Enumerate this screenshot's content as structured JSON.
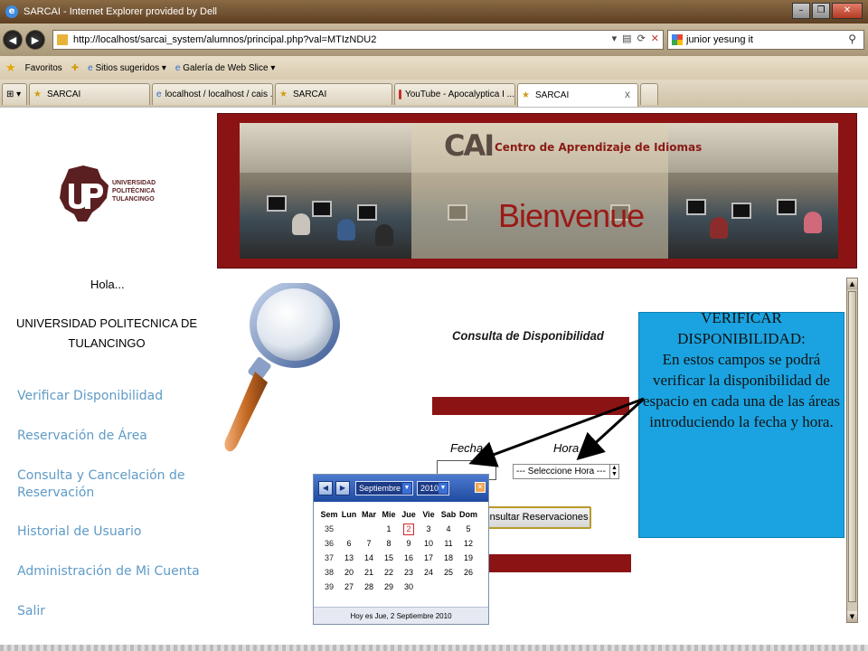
{
  "window": {
    "title": "SARCAI - Internet Explorer provided by Dell"
  },
  "browser": {
    "url": "http://localhost/sarcai_system/alumnos/principal.php?val=MTIzNDU2",
    "search_value": "junior yesung it",
    "favorites_label": "Favoritos",
    "suggested_sites_label": "Sitios sugeridos",
    "web_slice_label": "Galería de Web Slice",
    "tabs": [
      {
        "label": "SARCAI",
        "active": false
      },
      {
        "label": "localhost / localhost / cais ...",
        "active": false
      },
      {
        "label": "SARCAI",
        "active": false
      },
      {
        "label": "YouTube - Apocalyptica I ...",
        "active": false
      },
      {
        "label": "SARCAI",
        "active": true
      }
    ]
  },
  "sidebar": {
    "logo_text": [
      "UNIVERSIDAD",
      "POLITÉCNICA",
      "TULANCINGO"
    ],
    "greeting": "Hola...",
    "user_name": "UNIVERSIDAD POLITECNICA DE TULANCINGO",
    "nav": [
      {
        "label": "Verificar Disponibilidad"
      },
      {
        "label": "Reservación de Área"
      },
      {
        "label": "Consulta y Cancelación de Reservación"
      },
      {
        "label": "Historial de Usuario"
      },
      {
        "label": "Administración de Mi Cuenta"
      },
      {
        "label": "Salir"
      }
    ],
    "nav_color": "#5f9bc7"
  },
  "banner": {
    "logo": "CAI",
    "center_name": "Centro de Aprendizaje de Idiomas",
    "welcome": "Bienvenue",
    "frame_color": "#8c1314"
  },
  "form": {
    "title": "Consulta de Disponibilidad",
    "fecha_label": "Fecha",
    "hora_label": "Hora",
    "fecha_value": "",
    "hora_selected": "--- Seleccione Hora ---",
    "submit_label": "Consultar Reservaciones"
  },
  "calendar": {
    "month": "Septiembre",
    "year": "2010",
    "headers": [
      "Sem",
      "Lun",
      "Mar",
      "Mie",
      "Jue",
      "Vie",
      "Sab",
      "Dom"
    ],
    "weeks": [
      [
        "35",
        "",
        "",
        "1",
        "2",
        "3",
        "4",
        "5"
      ],
      [
        "36",
        "6",
        "7",
        "8",
        "9",
        "10",
        "11",
        "12"
      ],
      [
        "37",
        "13",
        "14",
        "15",
        "16",
        "17",
        "18",
        "19"
      ],
      [
        "38",
        "20",
        "21",
        "22",
        "23",
        "24",
        "25",
        "26"
      ],
      [
        "39",
        "27",
        "28",
        "29",
        "30",
        "",
        "",
        ""
      ]
    ],
    "today_day": "2",
    "footer": "Hoy es Jue, 2 Septiembre 2010"
  },
  "callout": {
    "title": "VERIFICAR DISPONIBILIDAD:",
    "body": "En estos campos se podrá verificar la disponibilidad de espacio en  cada una de las áreas introduciendo la fecha y hora.",
    "color": "#1aa3e0"
  }
}
